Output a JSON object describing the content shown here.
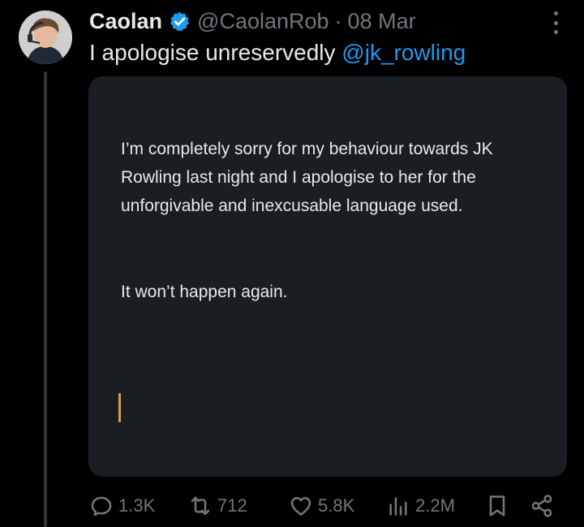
{
  "tweet": {
    "display_name": "Caolan",
    "handle": "@CaolanRob",
    "separator": "·",
    "date": "08 Mar",
    "text": "I apologise unreservedly",
    "mention": "@jk_rowling"
  },
  "media": {
    "paragraph_1": "I’m completely sorry for my behaviour towards JK Rowling last night and I apologise to her for the unforgivable and inexcusable language used.",
    "paragraph_2": "It won’t happen again."
  },
  "actions": {
    "replies": "1.3K",
    "reposts": "712",
    "likes": "5.8K",
    "views": "2.2M"
  },
  "colors": {
    "background": "#000000",
    "text_primary": "#e7e9ea",
    "text_secondary": "#71767b",
    "accent_blue": "#1d9bf0",
    "card_background": "#1a1d22",
    "cursor": "#d4a140"
  },
  "icons": {
    "verified": "verified-badge-icon",
    "more": "more-options-icon",
    "reply": "reply-icon",
    "repost": "repost-icon",
    "like": "heart-icon",
    "views": "views-icon",
    "bookmark": "bookmark-icon",
    "share": "share-icon"
  }
}
